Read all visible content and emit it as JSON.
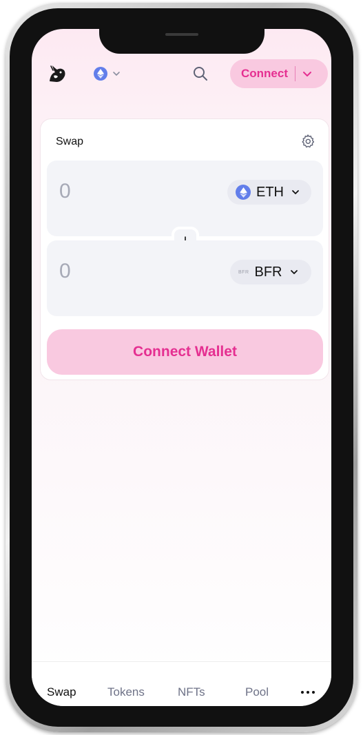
{
  "header": {
    "connect_label": "Connect"
  },
  "swap_card": {
    "title": "Swap",
    "input": {
      "amount": "0",
      "token_symbol": "ETH"
    },
    "output": {
      "amount": "0",
      "token_symbol": "BFR",
      "token_badge": "BFR"
    },
    "connect_wallet_label": "Connect Wallet"
  },
  "bottom_nav": {
    "items": [
      {
        "label": "Swap"
      },
      {
        "label": "Tokens"
      },
      {
        "label": "NFTs"
      },
      {
        "label": "Pool"
      }
    ]
  },
  "icons": {
    "logo": "unicorn-logo-icon",
    "network": "ethereum-icon",
    "search": "search-icon",
    "settings": "gear-icon",
    "swap_direction": "arrow-down-icon",
    "more": "more-dots-icon"
  },
  "colors": {
    "accent": "#e52f91",
    "accent_bg": "#f9c9e0",
    "ethereum": "#627eea",
    "panel_bg": "#f3f4f8"
  }
}
